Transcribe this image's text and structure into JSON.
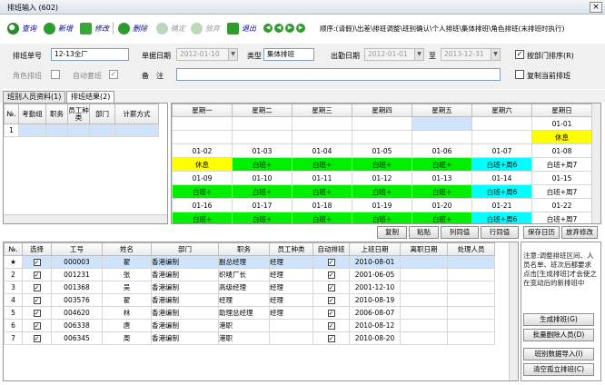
{
  "window": {
    "title": "排班输入 (602)",
    "close": "×"
  },
  "toolbar": {
    "query": "查询",
    "add": "新增",
    "edit": "修改",
    "delete": "删除",
    "confirm": "确定",
    "abandon": "放弃",
    "exit": "退出",
    "flow": "顺序:(请假)\\出差\\排班调整\\班别确认\\个人排班\\集体排班\\角色排班(末排班时执行)",
    "nav": [
      "◀",
      "◀",
      "▶",
      "▶"
    ]
  },
  "form": {
    "schedule_no_label": "排班单号",
    "schedule_no": "12-13全厂",
    "doc_date_label": "单据日期",
    "doc_date": "2012-01-10",
    "type_label": "类型",
    "type": "集体排班",
    "attend_date_label": "出勤日期",
    "attend_from": "2012-01-01",
    "to_label": "至",
    "attend_to": "2013-12-31",
    "role_label": "角色排班",
    "auto_label": "自动套班",
    "remark_label": "备　注",
    "remark": "",
    "sort_dept_label": "按部门排序(R)",
    "copy_label": "复制当前排班"
  },
  "tabs": [
    "班别人员资料(1)",
    "排班结果(2)"
  ],
  "upper_left": {
    "headers": [
      "№.",
      "考勤组",
      "职务",
      "员工种类",
      "部门",
      "计薪方式"
    ],
    "rows": [
      [
        "1",
        "",
        "",
        "",
        "",
        ""
      ]
    ]
  },
  "calendar": {
    "headers": [
      "星期一",
      "星期二",
      "星期三",
      "星期四",
      "星期五",
      "星期六",
      "星期日"
    ],
    "rows": [
      [
        "",
        "",
        "",
        "",
        "",
        "",
        "01-01"
      ],
      [
        "",
        "",
        "",
        "",
        "",
        "",
        "休息"
      ],
      [
        "01-02",
        "01-03",
        "01-04",
        "01-05",
        "01-06",
        "01-07",
        "01-08"
      ],
      [
        "休息",
        "白班+",
        "白班+",
        "白班+",
        "白班+",
        "白班+周6",
        "白班+周7"
      ],
      [
        "01-09",
        "01-10",
        "01-11",
        "01-12",
        "01-13",
        "01-14",
        "01-15"
      ],
      [
        "白班+",
        "白班+",
        "白班+",
        "白班+",
        "白班+",
        "白班+周6",
        "白班+周7"
      ],
      [
        "01-16",
        "01-17",
        "01-18",
        "01-19",
        "01-20",
        "01-21",
        "01-22"
      ],
      [
        "白班+",
        "白班+",
        "白班+",
        "白班+",
        "白班+",
        "白班+周6",
        "白班+周7"
      ]
    ]
  },
  "mid_buttons": [
    "复制",
    "粘贴",
    "列同值",
    "行同值",
    "保存日历",
    "放弃修改"
  ],
  "employees": {
    "headers": [
      "№.",
      "选择",
      "工号",
      "姓名",
      "部门",
      "职务",
      "员工种类",
      "自动排班",
      "上班日期",
      "离职日期",
      "处理人员"
    ],
    "rows": [
      [
        "★",
        "✓",
        "000003",
        "翟",
        "香港编制",
        "副总经理",
        "经理",
        "✓",
        "2010-08-01",
        "",
        ""
      ],
      [
        "2",
        "✓",
        "001231",
        "张",
        "香港编制",
        "织唛厂长",
        "经理",
        "✓",
        "2001-06-05",
        "",
        ""
      ],
      [
        "3",
        "✓",
        "001368",
        "吴",
        "香港编制",
        "高级经理",
        "经理",
        "✓",
        "2001-12-10",
        "",
        ""
      ],
      [
        "4",
        "✓",
        "003576",
        "翟",
        "香港编制",
        "经理",
        "经理",
        "✓",
        "2010-08-19",
        "",
        ""
      ],
      [
        "5",
        "✓",
        "004620",
        "林",
        "香港编制",
        "助理总经理",
        "经理",
        "✓",
        "2006-08-07",
        "",
        ""
      ],
      [
        "6",
        "✓",
        "006338",
        "唐",
        "香港编制",
        "港职",
        "",
        "✓",
        "2010-08-12",
        "",
        ""
      ],
      [
        "7",
        "✓",
        "006345",
        "周",
        "香港编制",
        "港职",
        "",
        "✓",
        "2010-08-20",
        "",
        ""
      ]
    ]
  },
  "side": {
    "note": "注意:调整排班区间、人员名单、班次后都要求点击[生成排班]才会使之在变动后的新排班中",
    "generate": "生成排班(G)",
    "batch_delete": "批量删除人员(D)",
    "import": "班别数据导入(I)",
    "clear": "清空孤立排班(C)"
  },
  "colors": {
    "work": "#00ef00",
    "rest": "#ffff00",
    "weekend": "#00ffff",
    "selected": "#cfe4fb"
  }
}
